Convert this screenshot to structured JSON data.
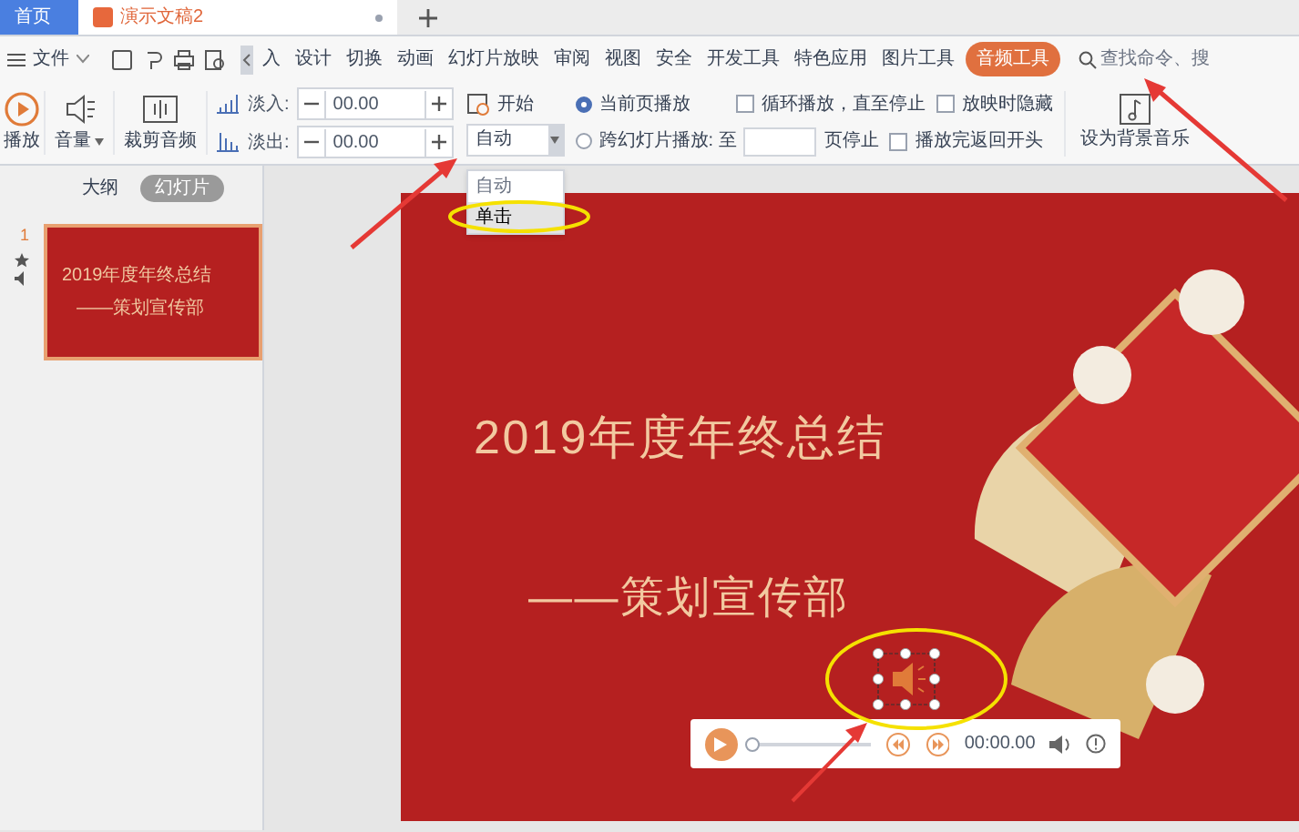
{
  "browser_tabs": [
    {
      "label": "首页",
      "selected": false
    },
    {
      "label": "演示文稿2",
      "selected": true
    }
  ],
  "menu": {
    "file": "文件",
    "items": [
      {
        "label": "入",
        "selected": false
      },
      {
        "label": "设计",
        "selected": false
      },
      {
        "label": "切换",
        "selected": false
      },
      {
        "label": "动画",
        "selected": false
      },
      {
        "label": "幻灯片放映",
        "selected": false
      },
      {
        "label": "审阅",
        "selected": false
      },
      {
        "label": "视图",
        "selected": false
      },
      {
        "label": "安全",
        "selected": false
      },
      {
        "label": "开发工具",
        "selected": false
      },
      {
        "label": "特色应用",
        "selected": false
      },
      {
        "label": "图片工具",
        "selected": false
      },
      {
        "label": "音频工具",
        "selected": true
      }
    ],
    "search": {
      "placeholder": "查找命令、搜"
    }
  },
  "ribbon": {
    "play": "播放",
    "volume": "音量",
    "trim": "裁剪音频",
    "fade_in": {
      "label": "淡入:",
      "value": "00.00"
    },
    "fade_out": {
      "label": "淡出:",
      "value": "00.00"
    },
    "start": {
      "label": "开始",
      "value": "自动",
      "options": [
        {
          "label": "自动",
          "highlighted": false
        },
        {
          "label": "单击",
          "highlighted": true
        }
      ]
    },
    "play_modes": [
      {
        "label": "当前页播放",
        "selected": true
      },
      {
        "label": "跨幻灯片播放: 至",
        "selected": false
      }
    ],
    "page_stop": "页停止",
    "options": [
      {
        "label": "循环播放，直至停止",
        "checked": false
      },
      {
        "label": "放映时隐藏",
        "checked": false
      },
      {
        "label": "播放完返回开头",
        "checked": false
      }
    ],
    "background_music": "设为背景音乐"
  },
  "panel": {
    "tabs": [
      {
        "label": "大纲",
        "selected": false
      },
      {
        "label": "幻灯片",
        "selected": true
      }
    ],
    "slides": [
      {
        "number": "1",
        "title": "2019年度年终总结",
        "subtitle": "——策划宣传部",
        "selected": true
      }
    ]
  },
  "slide": {
    "title": "2019年度年终总结",
    "subtitle": "——策划宣传部",
    "player": {
      "time": "00:00.00",
      "level": 0
    }
  }
}
